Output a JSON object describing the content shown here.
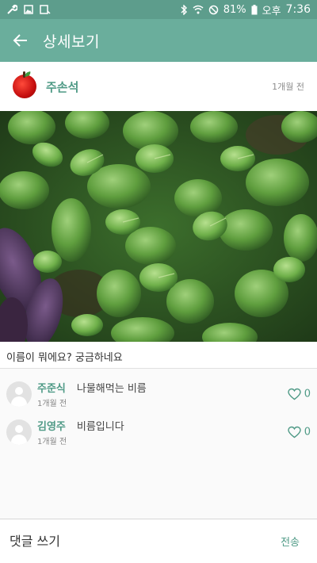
{
  "status_bar": {
    "battery": "81%",
    "ampm": "오후",
    "time": "7:36"
  },
  "app_bar": {
    "title": "상세보기"
  },
  "post": {
    "author": "주손석",
    "time": "1개월 전",
    "caption": "이름이 뭐에요? 궁금하네요"
  },
  "comments": [
    {
      "author": "주준식",
      "text": "나물해먹는 비름",
      "time": "1개월 전",
      "likes": "0"
    },
    {
      "author": "김영주",
      "text": "비름입니다",
      "time": "1개월 전",
      "likes": "0"
    }
  ],
  "composer": {
    "placeholder": "댓글 쓰기",
    "send_label": "전송"
  },
  "colors": {
    "app_bar": "#6aae9c",
    "status_bar": "#5d9d8c",
    "accent": "#4f9a86"
  }
}
